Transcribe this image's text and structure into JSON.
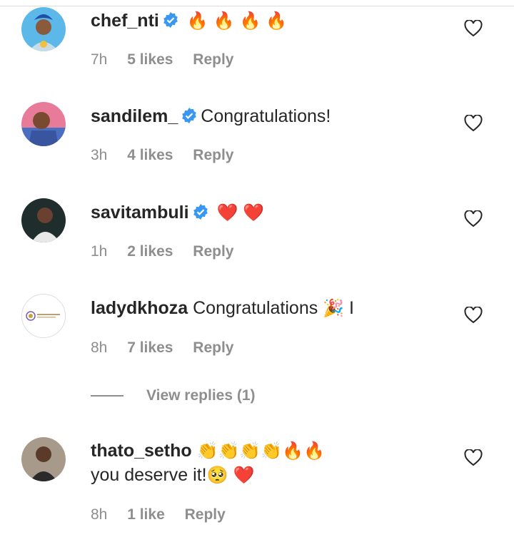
{
  "colors": {
    "text": "#262626",
    "muted": "#8e8e8e",
    "verified": "#3897f0",
    "heart": "#ed1c24"
  },
  "comments": [
    {
      "username": "chef_nti",
      "verified": true,
      "emojis": [
        "🔥",
        "🔥",
        "🔥",
        "🔥"
      ],
      "time": "7h",
      "likes": "5 likes",
      "reply": "Reply",
      "avatar_icon": "avatar-chef"
    },
    {
      "username": "sandilem_",
      "verified": true,
      "text": "Congratulations!",
      "time": "3h",
      "likes": "4 likes",
      "reply": "Reply",
      "avatar_icon": "avatar-sandile"
    },
    {
      "username": "savitambuli",
      "verified": true,
      "emojis": [
        "❤️",
        "❤️"
      ],
      "time": "1h",
      "likes": "2 likes",
      "reply": "Reply",
      "avatar_icon": "avatar-savita"
    },
    {
      "username": "ladydkhoza",
      "verified": false,
      "text": "Congratulations",
      "emojis": [
        "🎉"
      ],
      "trail": "I",
      "time": "8h",
      "likes": "7 likes",
      "reply": "Reply",
      "avatar_icon": "avatar-ladyd"
    },
    {
      "username": "thato_setho",
      "verified": false,
      "emojis": [
        "👏",
        "👏",
        "👏",
        "👏",
        "🔥",
        "🔥"
      ],
      "text_after": "you deserve it!",
      "emojis_after": [
        "🥺",
        "❤️"
      ],
      "time": "8h",
      "likes": "1 like",
      "reply": "Reply",
      "avatar_icon": "avatar-thato"
    }
  ],
  "view_replies": "View replies (1)"
}
